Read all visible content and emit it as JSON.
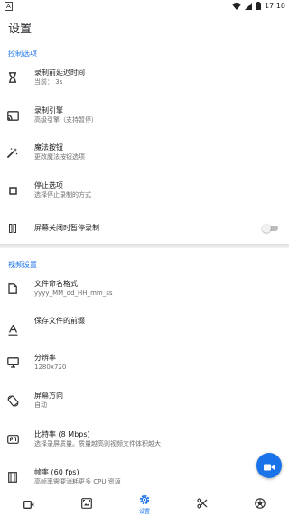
{
  "status_bar": {
    "left_glyph": "A",
    "time": "17:10"
  },
  "app": {
    "title": "设置"
  },
  "sections": {
    "control": {
      "header": "控制选项",
      "items": [
        {
          "icon": "hourglass-icon",
          "title": "录制前延迟时间",
          "subtitle": "当前： 3s"
        },
        {
          "icon": "cast-icon",
          "title": "录制引擎",
          "subtitle": "高级引擎（支持暂停）"
        },
        {
          "icon": "magic-wand-icon",
          "title": "魔法按钮",
          "subtitle": "更改魔法按钮选项"
        },
        {
          "icon": "stop-icon",
          "title": "停止选项",
          "subtitle": "选择停止录制的方式"
        },
        {
          "icon": "pause-icon",
          "title": "屏幕关闭时暂停录制",
          "toggle_on": false
        }
      ]
    },
    "video": {
      "header": "视频设置",
      "items": [
        {
          "icon": "file-icon",
          "title": "文件命名格式",
          "subtitle": "yyyy_MM_dd_HH_mm_ss"
        },
        {
          "icon": "text-prefix-icon",
          "title": "保存文件的前缀",
          "subtitle": ""
        },
        {
          "icon": "monitor-icon",
          "title": "分辨率",
          "subtitle": "1280x720"
        },
        {
          "icon": "screen-rotation-icon",
          "title": "屏幕方向",
          "subtitle": "自动"
        },
        {
          "icon": "bitrate-icon",
          "title": "比特率 (8 Mbps)",
          "subtitle": "选择录屏质量。质量越高则视频文件体积越大"
        },
        {
          "icon": "film-icon",
          "title": "帧率 (60 fps)",
          "subtitle": "高帧率需要消耗更多 CPU 资源"
        }
      ]
    }
  },
  "bottom_nav": {
    "items": [
      {
        "icon": "video-icon",
        "label": ""
      },
      {
        "icon": "screenshot-icon",
        "label": ""
      },
      {
        "icon": "settings-icon",
        "label": "设置",
        "selected": true
      },
      {
        "icon": "scissors-icon",
        "label": ""
      },
      {
        "icon": "soccer-ball-icon",
        "label": ""
      }
    ]
  },
  "colors": {
    "accent": "#1a73e8",
    "text_primary": "#202124",
    "text_secondary": "#6f6f6f",
    "divider": "#e0e0e0"
  }
}
